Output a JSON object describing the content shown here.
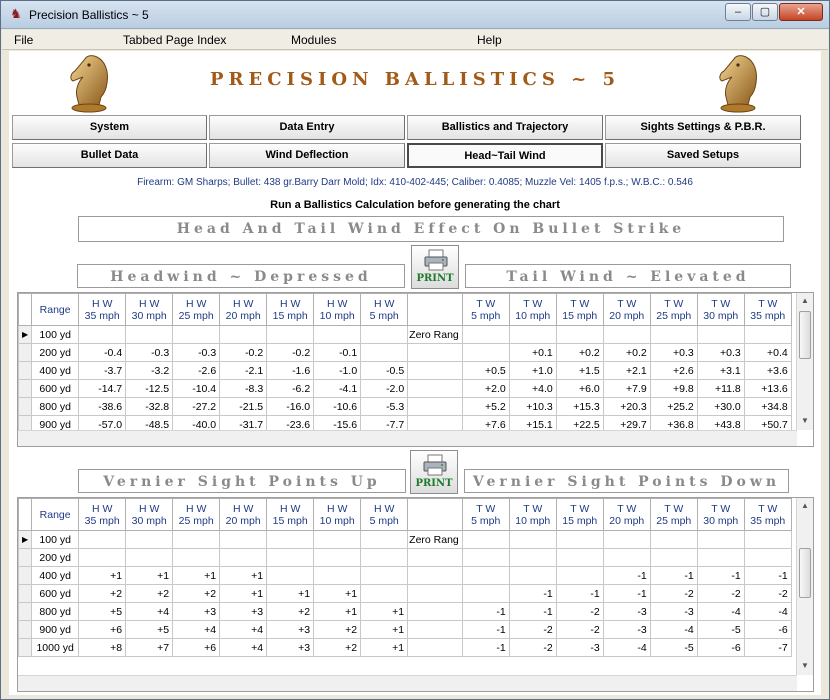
{
  "window": {
    "title": "Precision Ballistics ~ 5",
    "icon": "app-logo-icon",
    "controls": {
      "minimize": "–",
      "maximize": "▢",
      "close": "✕"
    }
  },
  "menu": [
    "File",
    "Tabbed Page Index",
    "Modules",
    "Help"
  ],
  "app_title": "PRECISION BALLISTICS ~ 5",
  "tabs_row1": [
    "System",
    "Data Entry",
    "Ballistics and Trajectory",
    "Sights Settings & P.B.R."
  ],
  "tabs_row2": [
    "Bullet Data",
    "Wind Deflection",
    "Head~Tail Wind",
    "Saved Setups"
  ],
  "active_tab": "Head~Tail Wind",
  "info_line": "Firearm: GM Sharps;   Bullet: 438 gr.Barry Darr Mold;   Idx: 410-402-445;   Caliber: 0.4085;   Muzzle Vel: 1405 f.p.s.;   W.B.C.: 0.546",
  "instruction": "Run a Ballistics Calculation  before generating the chart",
  "main_banner": "Head And Tail Wind Effect On Bullet Strike",
  "print_label": "PRINT",
  "colors": {
    "title": "#a35a18",
    "info": "#1f3b84",
    "print": "#1c7a2c"
  },
  "section1": {
    "left_banner": "Headwind ~ Depressed",
    "right_banner": "Tail Wind ~ Elevated",
    "table": {
      "range_header": "Range",
      "hw_headers": [
        [
          "H W",
          "35 mph"
        ],
        [
          "H W",
          "30 mph"
        ],
        [
          "H W",
          "25 mph"
        ],
        [
          "H W",
          "20 mph"
        ],
        [
          "H W",
          "15 mph"
        ],
        [
          "H W",
          "10 mph"
        ],
        [
          "H W",
          "5 mph"
        ]
      ],
      "tw_headers": [
        [
          "T W",
          "5 mph"
        ],
        [
          "T W",
          "10 mph"
        ],
        [
          "T W",
          "15 mph"
        ],
        [
          "T W",
          "20 mph"
        ],
        [
          "T W",
          "25 mph"
        ],
        [
          "T W",
          "30 mph"
        ],
        [
          "T W",
          "35 mph"
        ]
      ],
      "rows": [
        {
          "range": "100 yd",
          "hw": [
            "",
            "",
            "",
            "",
            "",
            "",
            ""
          ],
          "mid": "Zero Rang",
          "tw": [
            "",
            "",
            "",
            "",
            "",
            "",
            ""
          ],
          "selected": true
        },
        {
          "range": "200 yd",
          "hw": [
            "-0.4",
            "-0.3",
            "-0.3",
            "-0.2",
            "-0.2",
            "-0.1",
            ""
          ],
          "mid": "",
          "tw": [
            "",
            "+0.1",
            "+0.2",
            "+0.2",
            "+0.3",
            "+0.3",
            "+0.4"
          ]
        },
        {
          "range": "400 yd",
          "hw": [
            "-3.7",
            "-3.2",
            "-2.6",
            "-2.1",
            "-1.6",
            "-1.0",
            "-0.5"
          ],
          "mid": "",
          "tw": [
            "+0.5",
            "+1.0",
            "+1.5",
            "+2.1",
            "+2.6",
            "+3.1",
            "+3.6"
          ]
        },
        {
          "range": "600 yd",
          "hw": [
            "-14.7",
            "-12.5",
            "-10.4",
            "-8.3",
            "-6.2",
            "-4.1",
            "-2.0"
          ],
          "mid": "",
          "tw": [
            "+2.0",
            "+4.0",
            "+6.0",
            "+7.9",
            "+9.8",
            "+11.8",
            "+13.6"
          ]
        },
        {
          "range": "800 yd",
          "hw": [
            "-38.6",
            "-32.8",
            "-27.2",
            "-21.5",
            "-16.0",
            "-10.6",
            "-5.3"
          ],
          "mid": "",
          "tw": [
            "+5.2",
            "+10.3",
            "+15.3",
            "+20.3",
            "+25.2",
            "+30.0",
            "+34.8"
          ]
        },
        {
          "range": "900 yd",
          "hw": [
            "-57.0",
            "-48.5",
            "-40.0",
            "-31.7",
            "-23.6",
            "-15.6",
            "-7.7"
          ],
          "mid": "",
          "tw": [
            "+7.6",
            "+15.1",
            "+22.5",
            "+29.7",
            "+36.8",
            "+43.8",
            "+50.7"
          ]
        }
      ]
    }
  },
  "section2": {
    "left_banner": "Vernier Sight Points Up",
    "right_banner": "Vernier Sight Points Down",
    "table": {
      "range_header": "Range",
      "hw_headers": [
        [
          "H W",
          "35 mph"
        ],
        [
          "H W",
          "30 mph"
        ],
        [
          "H W",
          "25 mph"
        ],
        [
          "H W",
          "20 mph"
        ],
        [
          "H W",
          "15 mph"
        ],
        [
          "H W",
          "10 mph"
        ],
        [
          "H W",
          "5 mph"
        ]
      ],
      "tw_headers": [
        [
          "T W",
          "5 mph"
        ],
        [
          "T W",
          "10 mph"
        ],
        [
          "T W",
          "15 mph"
        ],
        [
          "T W",
          "20 mph"
        ],
        [
          "T W",
          "25 mph"
        ],
        [
          "T W",
          "30 mph"
        ],
        [
          "T W",
          "35 mph"
        ]
      ],
      "rows": [
        {
          "range": "100 yd",
          "hw": [
            "",
            "",
            "",
            "",
            "",
            "",
            ""
          ],
          "mid": "Zero Rang",
          "tw": [
            "",
            "",
            "",
            "",
            "",
            "",
            ""
          ],
          "selected": true
        },
        {
          "range": "200 yd",
          "hw": [
            "",
            "",
            "",
            "",
            "",
            "",
            ""
          ],
          "mid": "",
          "tw": [
            "",
            "",
            "",
            "",
            "",
            "",
            ""
          ]
        },
        {
          "range": "400 yd",
          "hw": [
            "+1",
            "+1",
            "+1",
            "+1",
            "",
            "",
            ""
          ],
          "mid": "",
          "tw": [
            "",
            "",
            "",
            "-1",
            "-1",
            "-1",
            "-1"
          ]
        },
        {
          "range": "600 yd",
          "hw": [
            "+2",
            "+2",
            "+2",
            "+1",
            "+1",
            "+1",
            ""
          ],
          "mid": "",
          "tw": [
            "",
            "-1",
            "-1",
            "-1",
            "-2",
            "-2",
            "-2"
          ]
        },
        {
          "range": "800 yd",
          "hw": [
            "+5",
            "+4",
            "+3",
            "+3",
            "+2",
            "+1",
            "+1"
          ],
          "mid": "",
          "tw": [
            "-1",
            "-1",
            "-2",
            "-3",
            "-3",
            "-4",
            "-4"
          ]
        },
        {
          "range": "900 yd",
          "hw": [
            "+6",
            "+5",
            "+4",
            "+4",
            "+3",
            "+2",
            "+1"
          ],
          "mid": "",
          "tw": [
            "-1",
            "-2",
            "-2",
            "-3",
            "-4",
            "-5",
            "-6"
          ]
        },
        {
          "range": "1000 yd",
          "hw": [
            "+8",
            "+7",
            "+6",
            "+4",
            "+3",
            "+2",
            "+1"
          ],
          "mid": "",
          "tw": [
            "-1",
            "-2",
            "-3",
            "-4",
            "-5",
            "-6",
            "-7"
          ]
        }
      ]
    }
  }
}
